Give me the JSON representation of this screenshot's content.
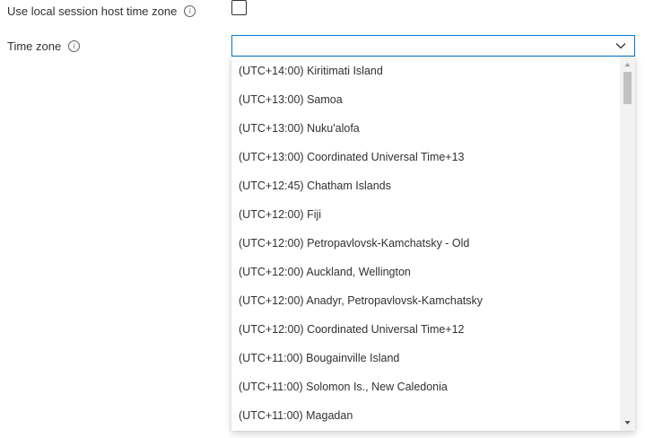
{
  "form": {
    "local_time_label": "Use local session host time zone",
    "local_time_checked": false,
    "time_zone_label": "Time zone",
    "time_zone_value": ""
  },
  "icons": {
    "info": "info-icon",
    "chevron": "chevron-down-icon"
  },
  "dropdown": {
    "options": [
      "(UTC+14:00) Kiritimati Island",
      "(UTC+13:00) Samoa",
      "(UTC+13:00) Nuku'alofa",
      "(UTC+13:00) Coordinated Universal Time+13",
      "(UTC+12:45) Chatham Islands",
      "(UTC+12:00) Fiji",
      "(UTC+12:00) Petropavlovsk-Kamchatsky - Old",
      "(UTC+12:00) Auckland, Wellington",
      "(UTC+12:00) Anadyr, Petropavlovsk-Kamchatsky",
      "(UTC+12:00) Coordinated Universal Time+12",
      "(UTC+11:00) Bougainville Island",
      "(UTC+11:00) Solomon Is., New Caledonia",
      "(UTC+11:00) Magadan"
    ]
  },
  "colors": {
    "accent": "#0078d4",
    "text": "#323130"
  }
}
